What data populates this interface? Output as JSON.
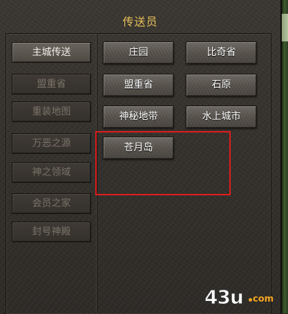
{
  "window": {
    "title": "传送员"
  },
  "sidebar": {
    "items": [
      {
        "label": "主城传送",
        "active": true
      },
      {
        "label": "盟重省",
        "active": false
      },
      {
        "label": "重装地图",
        "active": false
      },
      {
        "label": "万恶之源",
        "active": false
      },
      {
        "label": "神之领域",
        "active": false
      },
      {
        "label": "会员之家",
        "active": false
      },
      {
        "label": "封号神殿",
        "active": false
      }
    ]
  },
  "destinations": [
    {
      "label": "庄园"
    },
    {
      "label": "比奇省"
    },
    {
      "label": "盟重省"
    },
    {
      "label": "石原"
    },
    {
      "label": "神秘地带"
    },
    {
      "label": "水上城市"
    },
    {
      "label": "苍月岛"
    }
  ],
  "watermark": {
    "main": "43u",
    "suffix": "com"
  },
  "colors": {
    "title": "#e8c15a",
    "active_text": "#f2eee6",
    "inactive_text": "#7a7268",
    "highlight": "#e21d1d"
  }
}
